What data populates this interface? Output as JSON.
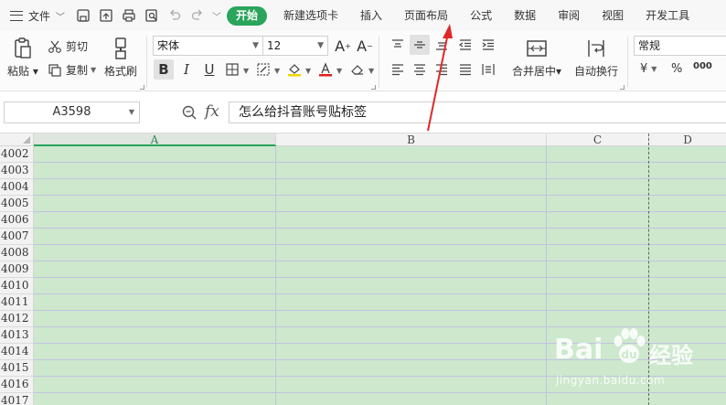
{
  "menubar": {
    "file_label": "文件",
    "tabs": [
      {
        "label": "开始",
        "active": true
      },
      {
        "label": "新建选项卡"
      },
      {
        "label": "插入"
      },
      {
        "label": "页面布局"
      },
      {
        "label": "公式"
      },
      {
        "label": "数据"
      },
      {
        "label": "审阅"
      },
      {
        "label": "视图"
      },
      {
        "label": "开发工具"
      }
    ],
    "accent_color": "#2aa55b"
  },
  "ribbon": {
    "paste_label": "粘贴",
    "cut_label": "剪切",
    "copy_label": "复制",
    "format_painter_label": "格式刷",
    "font_name": "宋体",
    "font_size": "12",
    "merge_label": "合并居中",
    "wrap_label": "自动换行",
    "number_format": "常规",
    "currency_symbol": "¥",
    "percent_symbol": "%",
    "thousands_symbol": "000"
  },
  "formula_bar": {
    "name_box": "A3598",
    "fx_label": "fx",
    "value": "怎么给抖音账号贴标签"
  },
  "grid": {
    "columns": [
      "A",
      "B",
      "C",
      "D"
    ],
    "selected_column": "A",
    "rows": [
      "4002",
      "4003",
      "4004",
      "4005",
      "4006",
      "4007",
      "4008",
      "4009",
      "4010",
      "4011",
      "4012",
      "4013",
      "4014",
      "4015",
      "4016",
      "4017"
    ],
    "fill_color": "#cde8cd"
  },
  "watermark": {
    "brand": "Bai",
    "brand_suffix": "经验",
    "url": "jingyan.baidu.com"
  }
}
